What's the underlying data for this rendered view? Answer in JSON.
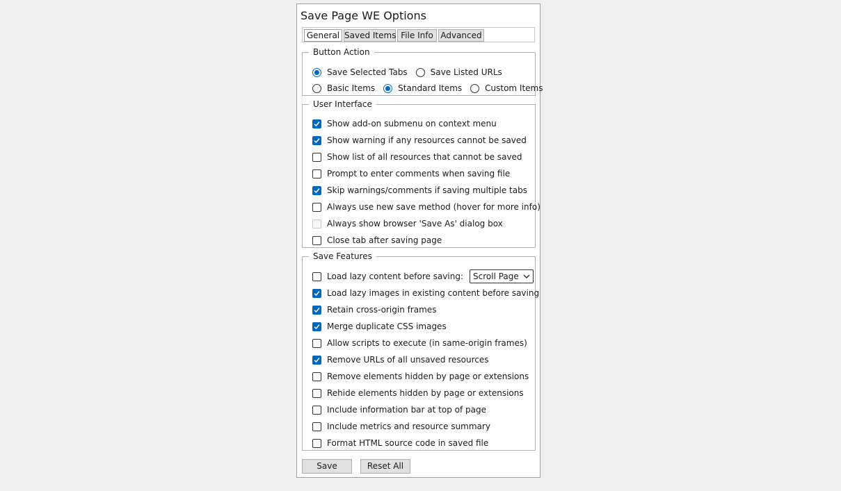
{
  "title": "Save Page WE Options",
  "tabs": [
    {
      "label": "General",
      "active": true
    },
    {
      "label": "Saved Items",
      "active": false
    },
    {
      "label": "File Info",
      "active": false
    },
    {
      "label": "Advanced",
      "active": false
    }
  ],
  "button_action": {
    "legend": "Button Action",
    "row1": [
      {
        "label": "Save Selected Tabs",
        "checked": true
      },
      {
        "label": "Save Listed URLs",
        "checked": false
      }
    ],
    "row2": [
      {
        "label": "Basic Items",
        "checked": false
      },
      {
        "label": "Standard Items",
        "checked": true
      },
      {
        "label": "Custom Items",
        "checked": false
      }
    ]
  },
  "user_interface": {
    "legend": "User Interface",
    "items": [
      {
        "label": "Show add-on submenu on context menu",
        "checked": true
      },
      {
        "label": "Show warning if any resources cannot be saved",
        "checked": true
      },
      {
        "label": "Show list of all resources that cannot be saved",
        "checked": false
      },
      {
        "label": "Prompt to enter comments when saving file",
        "checked": false
      },
      {
        "label": "Skip warnings/comments if saving multiple tabs",
        "checked": true
      },
      {
        "label": "Always use new save method (hover for more info)",
        "checked": false
      },
      {
        "label": "Always show browser 'Save As' dialog box",
        "checked": false,
        "disabled": true
      },
      {
        "label": "Close tab after saving page",
        "checked": false
      }
    ]
  },
  "save_features": {
    "legend": "Save Features",
    "lazy_label": "Load lazy content before saving:",
    "lazy_checked": false,
    "lazy_select_value": "Scroll Page",
    "items": [
      {
        "label": "Load lazy images in existing content before saving",
        "checked": true
      },
      {
        "label": "Retain cross-origin frames",
        "checked": true
      },
      {
        "label": "Merge duplicate CSS images",
        "checked": true
      },
      {
        "label": "Allow scripts to execute (in same-origin frames)",
        "checked": false
      },
      {
        "label": "Remove URLs of all unsaved resources",
        "checked": true
      },
      {
        "label": "Remove elements hidden by page or extensions",
        "checked": false
      },
      {
        "label": "Rehide elements hidden by page or extensions",
        "checked": false
      },
      {
        "label": "Include information bar at top of page",
        "checked": false
      },
      {
        "label": "Include metrics and resource summary",
        "checked": false
      },
      {
        "label": "Format HTML source code in saved file",
        "checked": false
      }
    ]
  },
  "buttons": {
    "save_label": "Save",
    "reset_label": "Reset All"
  },
  "colors": {
    "accent": "#0067c0",
    "background": "#f0f0f0",
    "panel": "#ffffff"
  }
}
